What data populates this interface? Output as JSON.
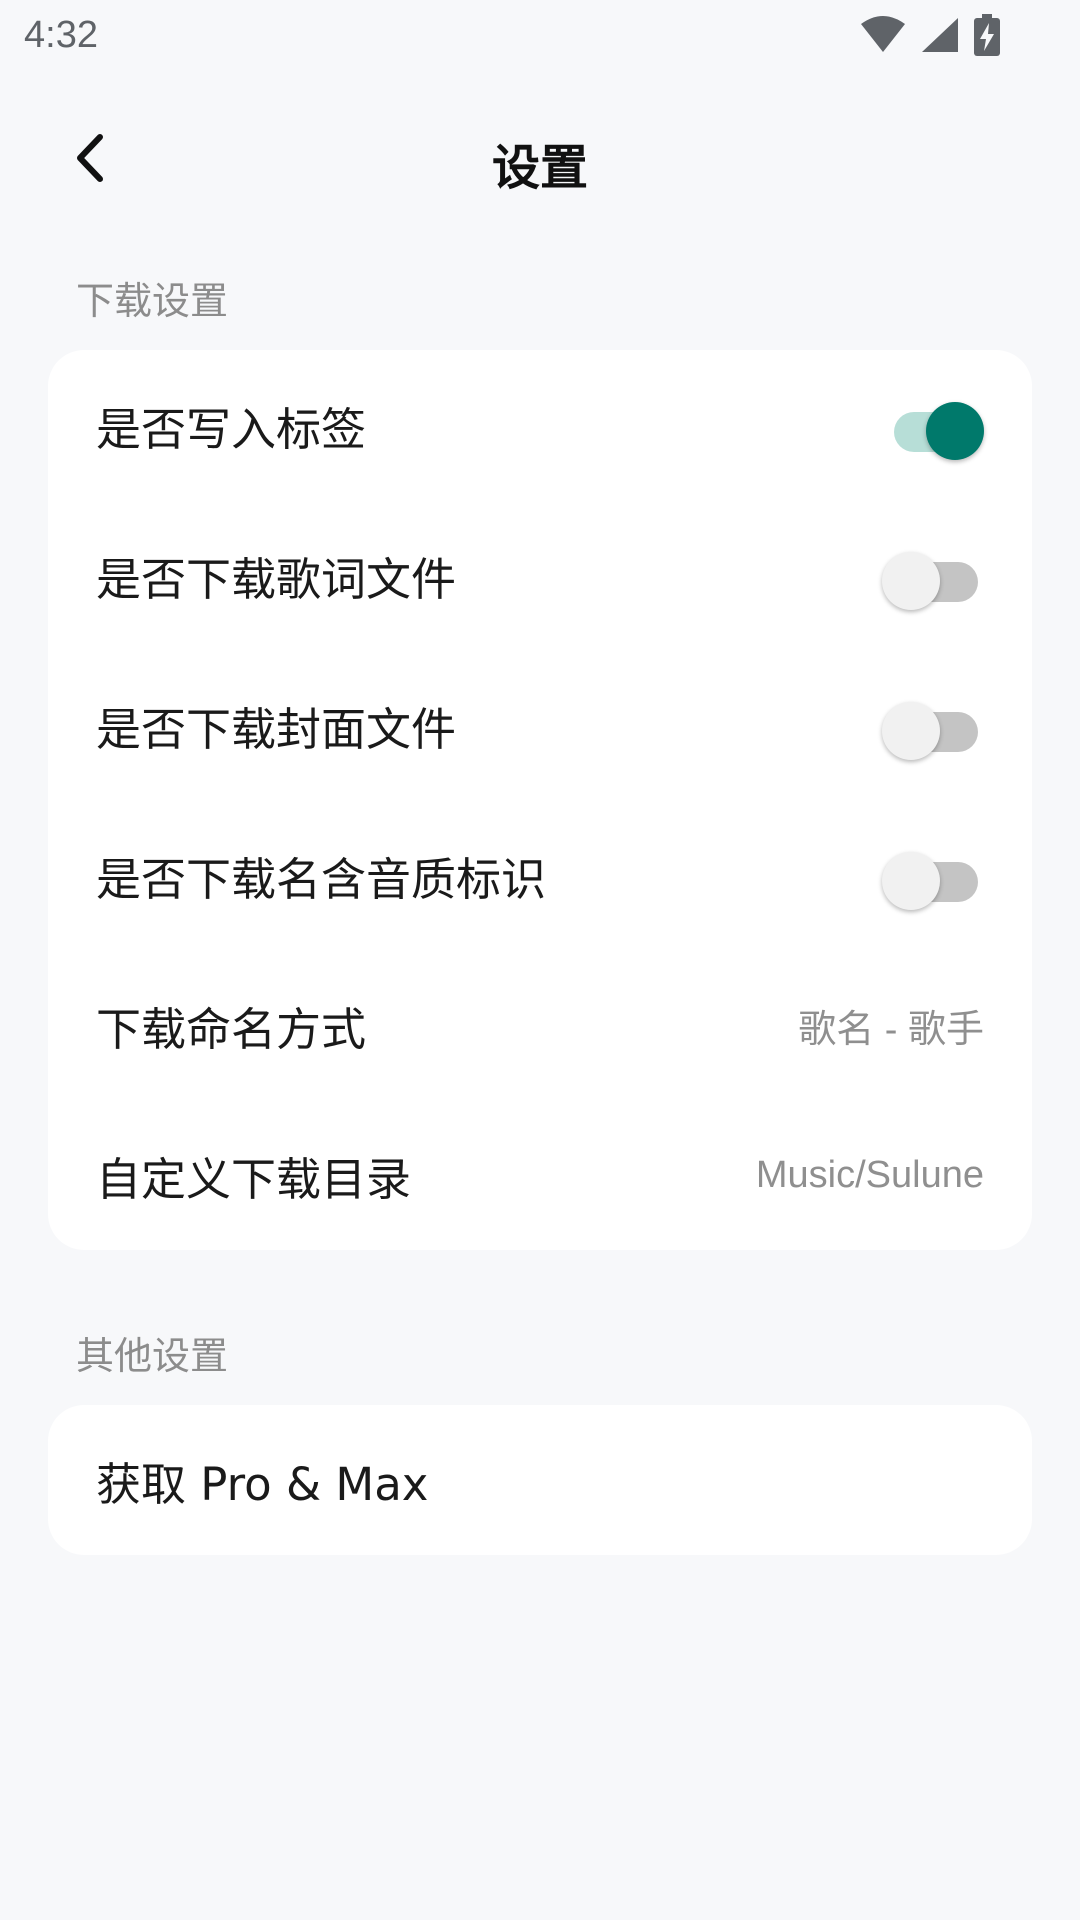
{
  "status_bar": {
    "time": "4:32",
    "icons": [
      "wifi-icon",
      "cellular-signal-icon",
      "battery-charging-icon"
    ]
  },
  "header": {
    "back_icon": "chevron-left-icon",
    "title": "设置"
  },
  "sections": {
    "download": {
      "title": "下载设置",
      "items": [
        {
          "label": "是否写入标签",
          "toggle": true
        },
        {
          "label": "是否下载歌词文件",
          "toggle": false
        },
        {
          "label": "是否下载封面文件",
          "toggle": false
        },
        {
          "label": "是否下载名含音质标识",
          "toggle": false
        },
        {
          "label": "下载命名方式",
          "value": "歌名 - 歌手"
        },
        {
          "label": "自定义下载目录",
          "value": "Music/Sulune"
        }
      ]
    },
    "other": {
      "title": "其他设置",
      "items": [
        {
          "label": "获取 Pro & Max"
        }
      ]
    }
  },
  "colors": {
    "accent": "#00796b",
    "accent_track": "#b7ded7",
    "background": "#f7f8fa",
    "card": "#ffffff",
    "secondary_text": "#8c8c8c"
  }
}
